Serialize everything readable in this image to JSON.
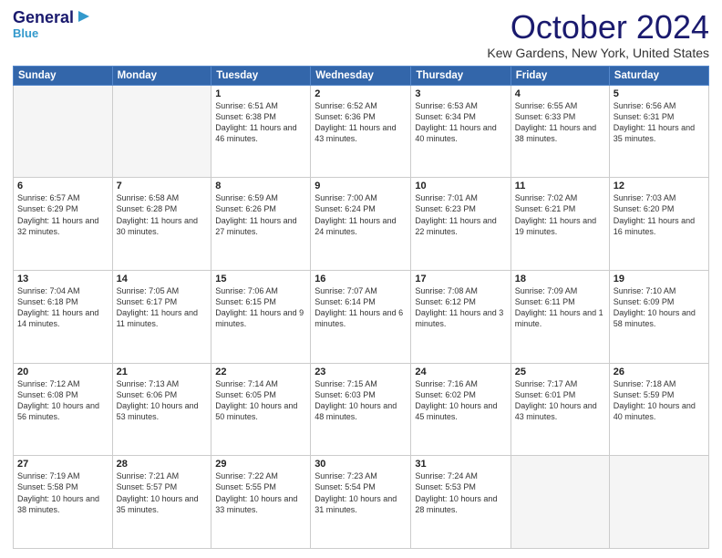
{
  "header": {
    "logo_general": "General",
    "logo_blue": "Blue",
    "month_title": "October 2024",
    "location": "Kew Gardens, New York, United States"
  },
  "days_of_week": [
    "Sunday",
    "Monday",
    "Tuesday",
    "Wednesday",
    "Thursday",
    "Friday",
    "Saturday"
  ],
  "weeks": [
    [
      {
        "day": "",
        "empty": true
      },
      {
        "day": "",
        "empty": true
      },
      {
        "day": "1",
        "sunrise": "6:51 AM",
        "sunset": "6:38 PM",
        "daylight": "11 hours and 46 minutes."
      },
      {
        "day": "2",
        "sunrise": "6:52 AM",
        "sunset": "6:36 PM",
        "daylight": "11 hours and 43 minutes."
      },
      {
        "day": "3",
        "sunrise": "6:53 AM",
        "sunset": "6:34 PM",
        "daylight": "11 hours and 40 minutes."
      },
      {
        "day": "4",
        "sunrise": "6:55 AM",
        "sunset": "6:33 PM",
        "daylight": "11 hours and 38 minutes."
      },
      {
        "day": "5",
        "sunrise": "6:56 AM",
        "sunset": "6:31 PM",
        "daylight": "11 hours and 35 minutes."
      }
    ],
    [
      {
        "day": "6",
        "sunrise": "6:57 AM",
        "sunset": "6:29 PM",
        "daylight": "11 hours and 32 minutes."
      },
      {
        "day": "7",
        "sunrise": "6:58 AM",
        "sunset": "6:28 PM",
        "daylight": "11 hours and 30 minutes."
      },
      {
        "day": "8",
        "sunrise": "6:59 AM",
        "sunset": "6:26 PM",
        "daylight": "11 hours and 27 minutes."
      },
      {
        "day": "9",
        "sunrise": "7:00 AM",
        "sunset": "6:24 PM",
        "daylight": "11 hours and 24 minutes."
      },
      {
        "day": "10",
        "sunrise": "7:01 AM",
        "sunset": "6:23 PM",
        "daylight": "11 hours and 22 minutes."
      },
      {
        "day": "11",
        "sunrise": "7:02 AM",
        "sunset": "6:21 PM",
        "daylight": "11 hours and 19 minutes."
      },
      {
        "day": "12",
        "sunrise": "7:03 AM",
        "sunset": "6:20 PM",
        "daylight": "11 hours and 16 minutes."
      }
    ],
    [
      {
        "day": "13",
        "sunrise": "7:04 AM",
        "sunset": "6:18 PM",
        "daylight": "11 hours and 14 minutes."
      },
      {
        "day": "14",
        "sunrise": "7:05 AM",
        "sunset": "6:17 PM",
        "daylight": "11 hours and 11 minutes."
      },
      {
        "day": "15",
        "sunrise": "7:06 AM",
        "sunset": "6:15 PM",
        "daylight": "11 hours and 9 minutes."
      },
      {
        "day": "16",
        "sunrise": "7:07 AM",
        "sunset": "6:14 PM",
        "daylight": "11 hours and 6 minutes."
      },
      {
        "day": "17",
        "sunrise": "7:08 AM",
        "sunset": "6:12 PM",
        "daylight": "11 hours and 3 minutes."
      },
      {
        "day": "18",
        "sunrise": "7:09 AM",
        "sunset": "6:11 PM",
        "daylight": "11 hours and 1 minute."
      },
      {
        "day": "19",
        "sunrise": "7:10 AM",
        "sunset": "6:09 PM",
        "daylight": "10 hours and 58 minutes."
      }
    ],
    [
      {
        "day": "20",
        "sunrise": "7:12 AM",
        "sunset": "6:08 PM",
        "daylight": "10 hours and 56 minutes."
      },
      {
        "day": "21",
        "sunrise": "7:13 AM",
        "sunset": "6:06 PM",
        "daylight": "10 hours and 53 minutes."
      },
      {
        "day": "22",
        "sunrise": "7:14 AM",
        "sunset": "6:05 PM",
        "daylight": "10 hours and 50 minutes."
      },
      {
        "day": "23",
        "sunrise": "7:15 AM",
        "sunset": "6:03 PM",
        "daylight": "10 hours and 48 minutes."
      },
      {
        "day": "24",
        "sunrise": "7:16 AM",
        "sunset": "6:02 PM",
        "daylight": "10 hours and 45 minutes."
      },
      {
        "day": "25",
        "sunrise": "7:17 AM",
        "sunset": "6:01 PM",
        "daylight": "10 hours and 43 minutes."
      },
      {
        "day": "26",
        "sunrise": "7:18 AM",
        "sunset": "5:59 PM",
        "daylight": "10 hours and 40 minutes."
      }
    ],
    [
      {
        "day": "27",
        "sunrise": "7:19 AM",
        "sunset": "5:58 PM",
        "daylight": "10 hours and 38 minutes."
      },
      {
        "day": "28",
        "sunrise": "7:21 AM",
        "sunset": "5:57 PM",
        "daylight": "10 hours and 35 minutes."
      },
      {
        "day": "29",
        "sunrise": "7:22 AM",
        "sunset": "5:55 PM",
        "daylight": "10 hours and 33 minutes."
      },
      {
        "day": "30",
        "sunrise": "7:23 AM",
        "sunset": "5:54 PM",
        "daylight": "10 hours and 31 minutes."
      },
      {
        "day": "31",
        "sunrise": "7:24 AM",
        "sunset": "5:53 PM",
        "daylight": "10 hours and 28 minutes."
      },
      {
        "day": "",
        "empty": true
      },
      {
        "day": "",
        "empty": true
      }
    ]
  ],
  "labels": {
    "sunrise": "Sunrise:",
    "sunset": "Sunset:",
    "daylight": "Daylight:"
  }
}
